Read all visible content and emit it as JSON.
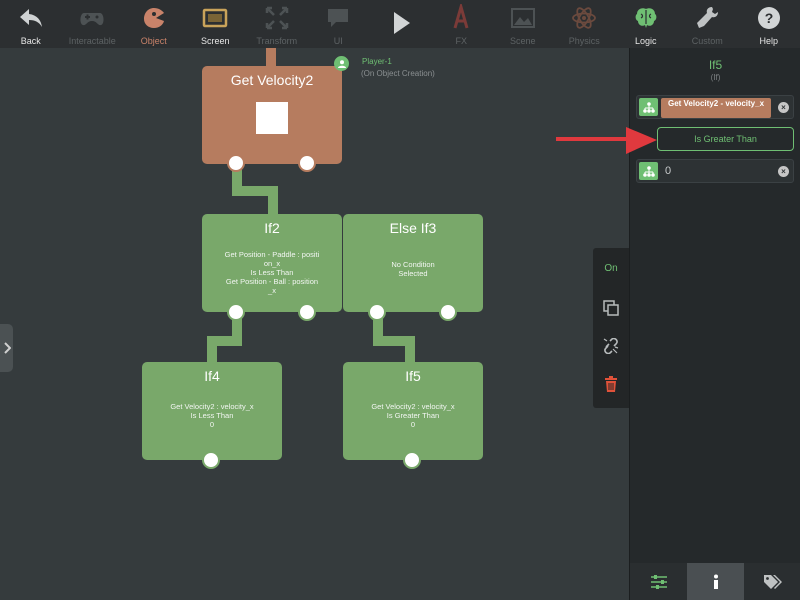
{
  "toolbar": {
    "items": [
      {
        "label": "Back",
        "icon": "back-arrow-icon",
        "state": "on"
      },
      {
        "label": "Interactable",
        "icon": "gamepad-icon",
        "state": "off"
      },
      {
        "label": "Object",
        "icon": "pacman-icon",
        "state": "on"
      },
      {
        "label": "Screen",
        "icon": "screen-icon",
        "state": "on"
      },
      {
        "label": "Transform",
        "icon": "transform-icon",
        "state": "off"
      },
      {
        "label": "UI",
        "icon": "speech-bubble-icon",
        "state": "off"
      },
      {
        "label": "",
        "icon": "play-icon",
        "state": "on"
      },
      {
        "label": "FX",
        "icon": "fx-icon",
        "state": "off"
      },
      {
        "label": "Scene",
        "icon": "landscape-icon",
        "state": "off"
      },
      {
        "label": "Physics",
        "icon": "atom-icon",
        "state": "off"
      },
      {
        "label": "Logic",
        "icon": "brain-icon",
        "state": "green"
      },
      {
        "label": "Custom",
        "icon": "wrench-icon",
        "state": "off"
      },
      {
        "label": "Help",
        "icon": "help-icon",
        "state": "on"
      }
    ]
  },
  "canvas": {
    "player": {
      "name": "Player-1",
      "trigger": "(On Object Creation)"
    },
    "nodes": {
      "get_velocity": {
        "title": "Get Velocity2"
      },
      "if2": {
        "title": "If2",
        "condition": [
          "Get Position - Paddle : positi",
          "on_x",
          "Is Less Than",
          "Get Position - Ball : position",
          "_x"
        ]
      },
      "elseif3": {
        "title": "Else If3",
        "condition": [
          "No Condition",
          "Selected"
        ]
      },
      "if4": {
        "title": "If4",
        "condition": [
          "Get Velocity2 : velocity_x",
          "Is Less Than",
          "0"
        ]
      },
      "if5": {
        "title": "If5",
        "condition": [
          "Get Velocity2 : velocity_x",
          "Is Greater Than",
          "0"
        ]
      }
    }
  },
  "actions": {
    "on_label": "On"
  },
  "panel": {
    "title": "If5",
    "subtitle": "(If)",
    "input_a": "Get Velocity2 - velocity_x",
    "operator": "Is Greater Than",
    "input_b": "0"
  },
  "colors": {
    "accent": "#6fbf73",
    "node_green": "#79a86a",
    "node_brown": "#b67c5f",
    "arrow_red": "#e0393e"
  }
}
